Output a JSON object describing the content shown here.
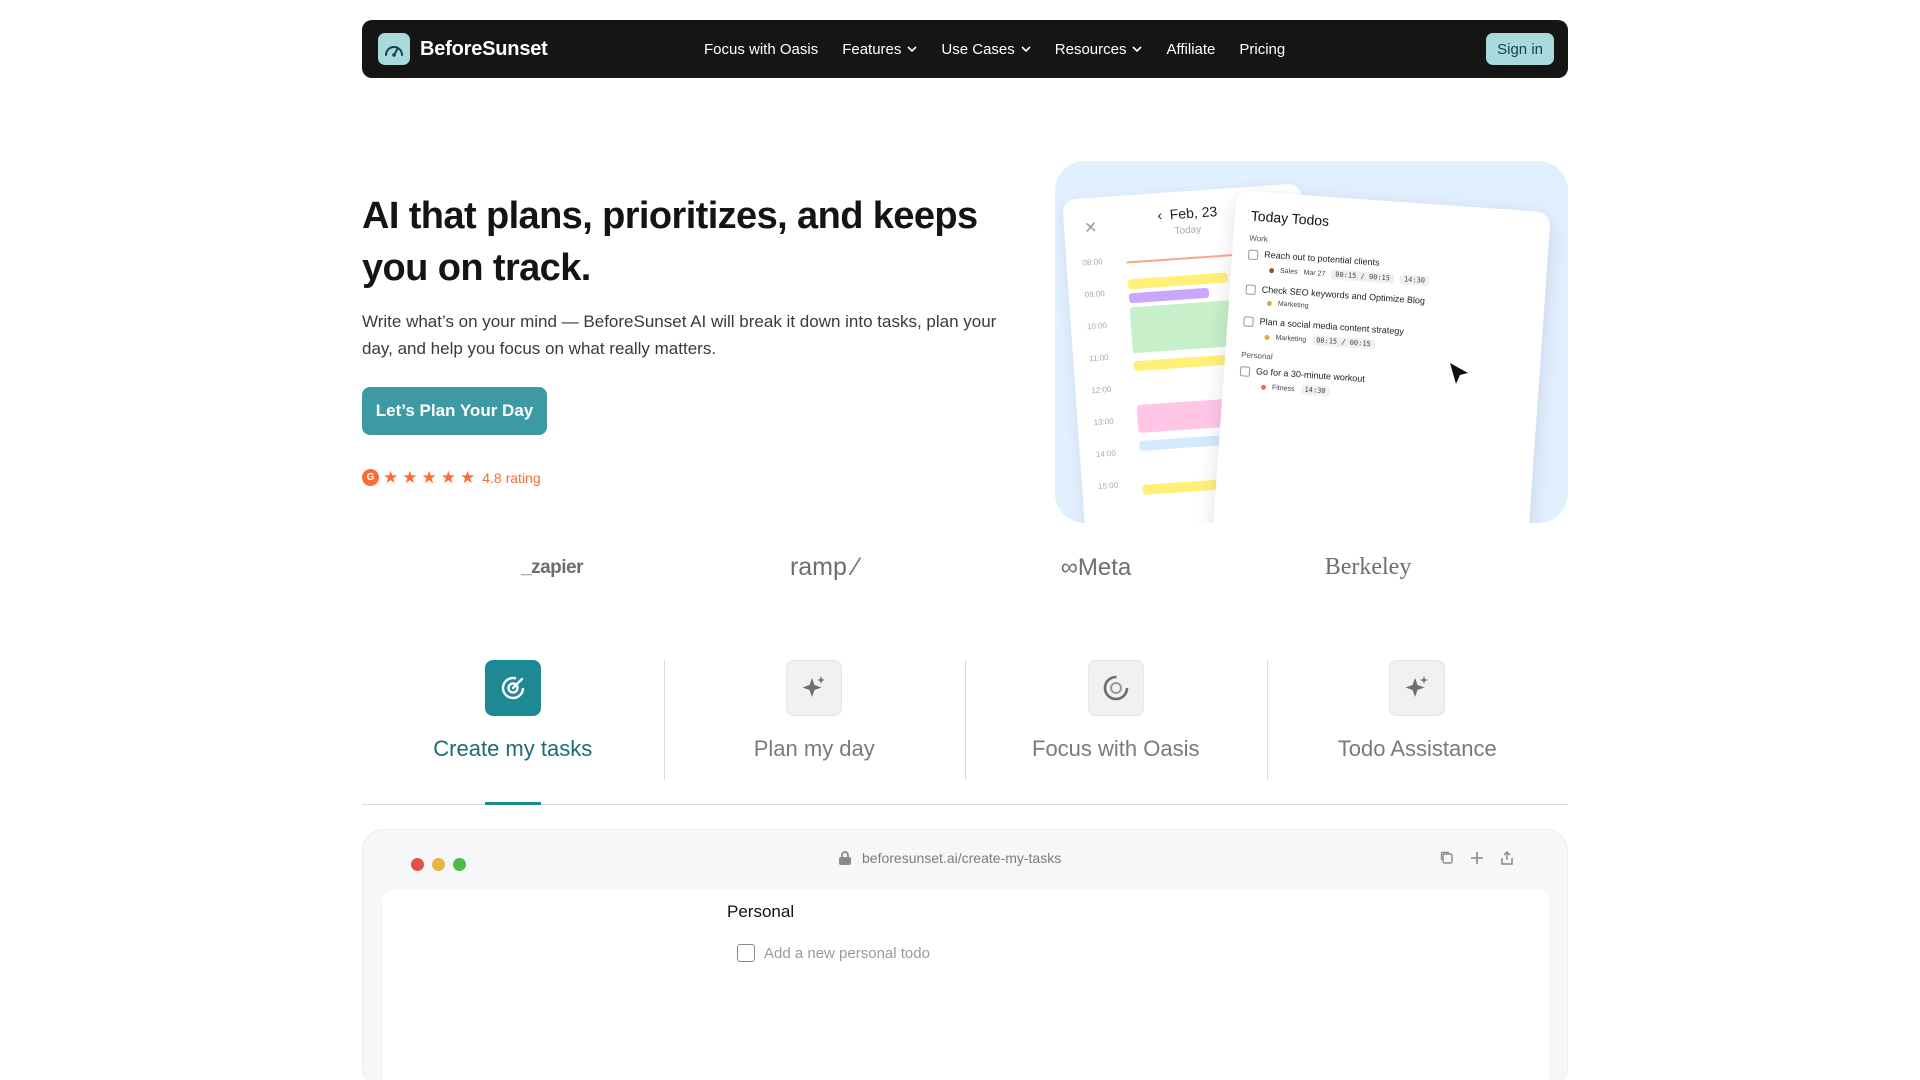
{
  "nav": {
    "brand": "BeforeSunset",
    "links": [
      {
        "label": "Focus with Oasis",
        "dropdown": false
      },
      {
        "label": "Features",
        "dropdown": true
      },
      {
        "label": "Use Cases",
        "dropdown": true
      },
      {
        "label": "Resources",
        "dropdown": true
      },
      {
        "label": "Affiliate",
        "dropdown": false
      },
      {
        "label": "Pricing",
        "dropdown": false
      }
    ],
    "signin": "Sign in"
  },
  "hero": {
    "title": "AI that plans, prioritizes, and keeps you on track.",
    "subtitle": "Write what’s on your mind — BeforeSunset AI will break it down into tasks, plan your day, and help you focus on what really matters.",
    "cta": "Let’s Plan Your Day",
    "rating": {
      "text": "4.8 rating",
      "stars": 5
    }
  },
  "preview": {
    "calendar": {
      "date": "Feb, 23",
      "today": "Today",
      "times": [
        "08:00",
        "09:00",
        "10:00",
        "11:00",
        "12:00",
        "13:00",
        "14:00",
        "15:00"
      ]
    },
    "todos": {
      "title": "Today Todos",
      "sections": [
        {
          "name": "Work",
          "items": [
            {
              "text": "Reach out to potential clients",
              "tag": "Sales",
              "date": "Mar 27",
              "time": "00:15 / 00:15",
              "clock": "14:30"
            },
            {
              "text": "Check SEO keywords and Optimize Blog",
              "tag": "Marketing"
            },
            {
              "text": "Plan a social media content strategy",
              "tag": "Marketing",
              "time": "00:15 / 00:15"
            }
          ]
        },
        {
          "name": "Personal",
          "items": [
            {
              "text": "Go for a 30-minute workout",
              "tag": "Fitness",
              "clock": "14:30"
            }
          ]
        }
      ]
    }
  },
  "logos": [
    "_zapier",
    "ramp",
    "Meta",
    "Berkeley"
  ],
  "tabs": [
    {
      "label": "Create my tasks",
      "icon": "target-icon",
      "active": true
    },
    {
      "label": "Plan my day",
      "icon": "sparkle-icon",
      "active": false
    },
    {
      "label": "Focus with Oasis",
      "icon": "focus-icon",
      "active": false
    },
    {
      "label": "Todo Assistance",
      "icon": "sparkle-icon",
      "active": false
    }
  ],
  "browser": {
    "url": "beforesunset.ai/create-my-tasks",
    "section": "Personal",
    "add_placeholder": "Add a new personal todo"
  },
  "colors": {
    "accent": "#3d9aa4",
    "nav_bg": "#151515",
    "rating": "#ff6b35",
    "hero_bg": "#e1efff"
  }
}
